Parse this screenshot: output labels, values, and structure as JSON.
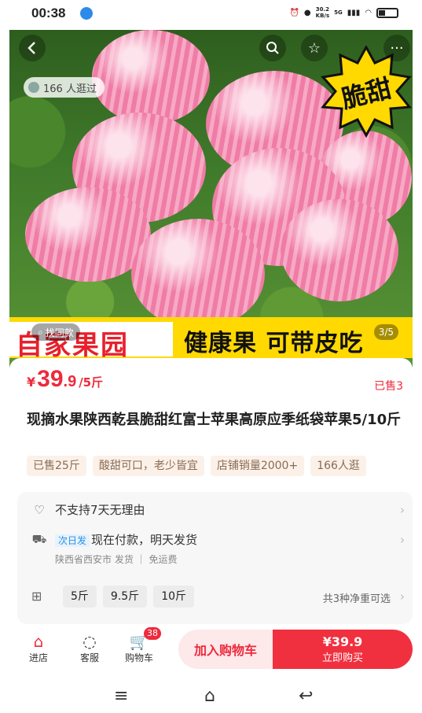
{
  "status_bar": {
    "time": "00:38",
    "net_speed": "30.2\nKB/s",
    "net_type": "5G"
  },
  "hero": {
    "visitors": "166 人逛过",
    "badge": "脆甜",
    "banner_left": "自家果园",
    "banner_right": "健康果 可带皮吃",
    "find_same": "找同款",
    "image_counter": "3/5"
  },
  "product": {
    "currency": "¥",
    "price_int": "39",
    "price_dec": ".9",
    "price_unit": "/5斤",
    "sold": "已售3",
    "title": "现摘水果陕西乾县脆甜红富士苹果高原应季纸袋苹果5/10斤",
    "tags": [
      "已售25斤",
      "酸甜可口，老少皆宜",
      "店铺销量2000+",
      "166人逛"
    ]
  },
  "service": {
    "return_policy": "不支持7天无理由",
    "shipping_badge": "次日发",
    "shipping_text": "现在付款，明天发货",
    "origin": "陕西省西安市 发货",
    "shipping_fee": "免运费",
    "options": [
      "5斤",
      "9.5斤",
      "10斤"
    ],
    "options_note": "共3种净重可选"
  },
  "bottom_bar": {
    "store": "进店",
    "service": "客服",
    "cart": "购物车",
    "cart_count": "38",
    "add_to_cart": "加入购物车",
    "buy_price": "¥39.9",
    "buy_now": "立即购买"
  },
  "colors": {
    "accent": "#ee2a3c",
    "banner_yellow": "#ffd900"
  }
}
